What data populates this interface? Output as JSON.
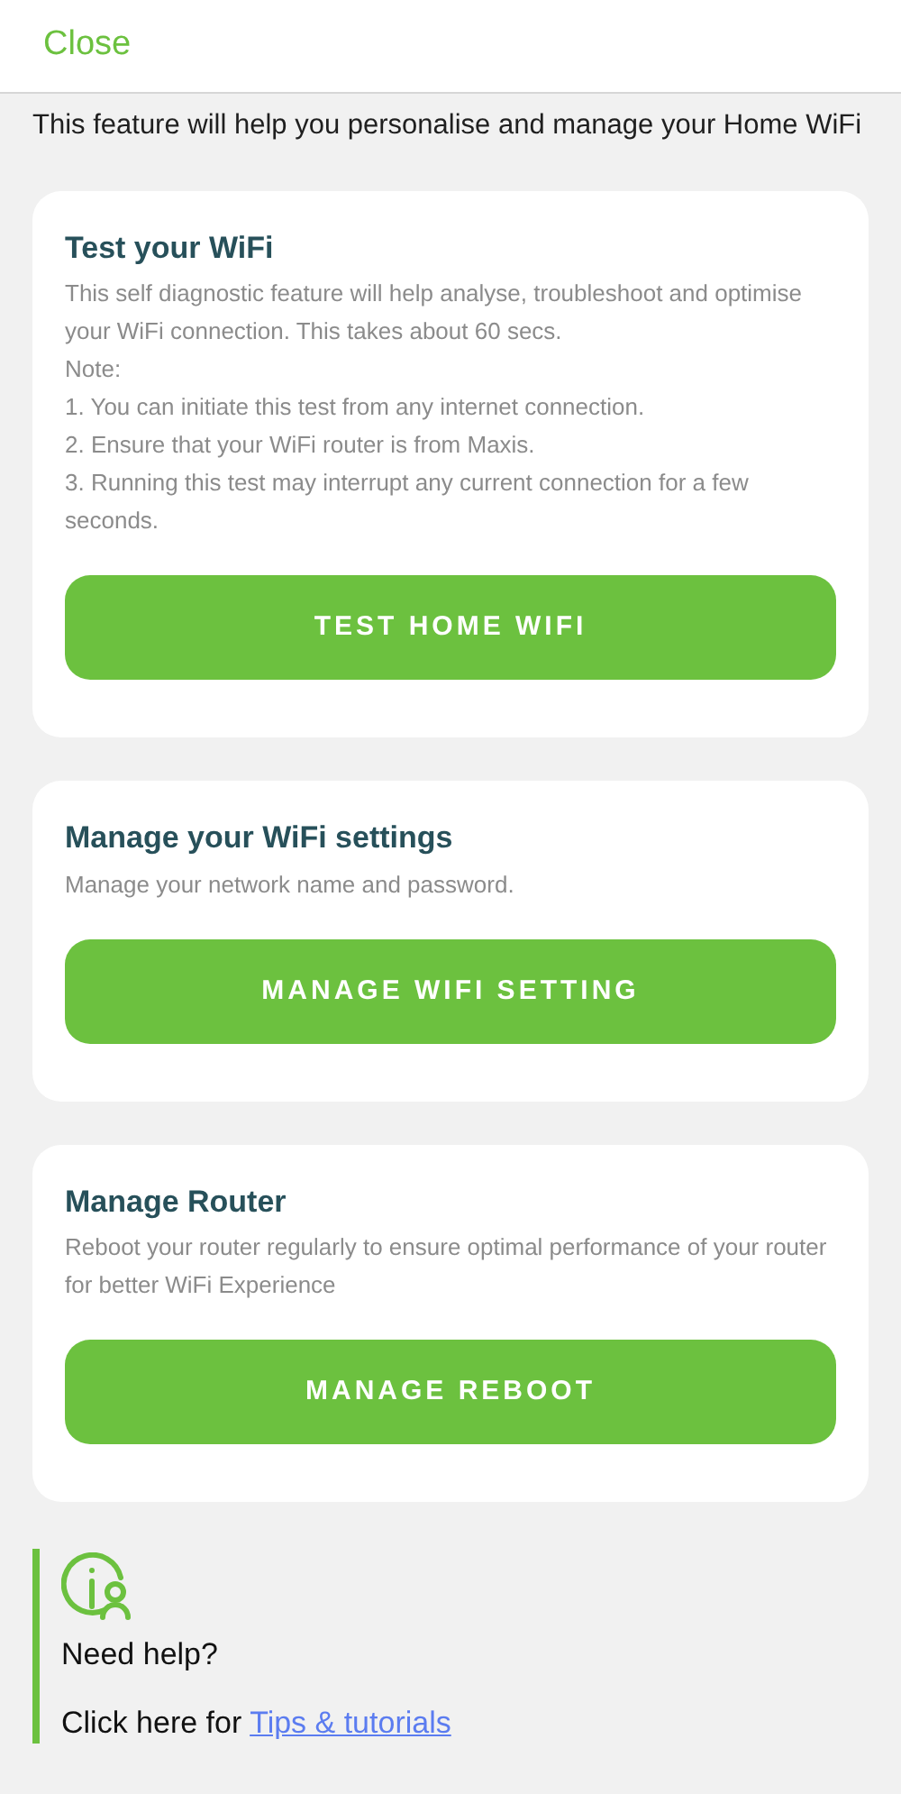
{
  "header": {
    "close": "Close"
  },
  "intro": "This feature will help you personalise and manage your Home WiFi",
  "cards": [
    {
      "title": "Test your WiFi",
      "lines": [
        "This self diagnostic feature will help analyse, troubleshoot and optimise your WiFi connection. This takes about 60 secs.",
        "Note:",
        "1. You can initiate this test from any internet connection.",
        "2. Ensure that your WiFi router is from Maxis.",
        "3. Running this test may interrupt any current connection for a few seconds."
      ],
      "button": "TEST HOME WIFI"
    },
    {
      "title": "Manage your WiFi settings",
      "lines": [
        "Manage your network name and password."
      ],
      "button": "MANAGE WIFI SETTING"
    },
    {
      "title": "Manage Router",
      "lines": [
        "Reboot your router regularly to ensure optimal performance of your router for better WiFi Experience"
      ],
      "button": "MANAGE REBOOT"
    }
  ],
  "help": {
    "title": "Need help?",
    "text": "Click here for",
    "link": "Tips & tutorials"
  }
}
